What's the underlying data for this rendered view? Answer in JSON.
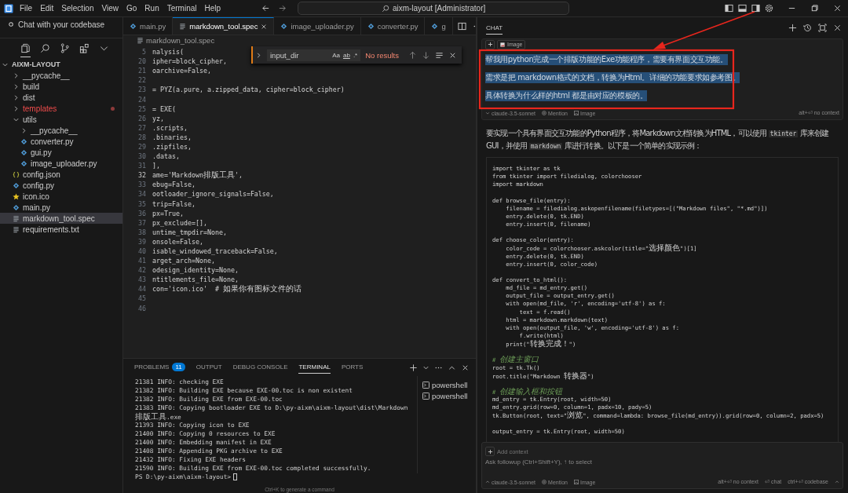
{
  "titlebar": {
    "menus": [
      "File",
      "Edit",
      "Selection",
      "View",
      "Go",
      "Run",
      "Terminal",
      "Help"
    ],
    "search": "aixm-layout [Administrator]"
  },
  "sidebar": {
    "chat_link": "Chat with your codebase",
    "views": [
      {
        "kind": "files",
        "selected": true
      },
      {
        "kind": "search",
        "selected": false
      },
      {
        "kind": "branch",
        "selected": false
      },
      {
        "kind": "extensions",
        "selected": false
      },
      {
        "kind": "more",
        "selected": false
      }
    ]
  },
  "explorer": {
    "title": "AIXM-LAYOUT",
    "expanded": true,
    "items": [
      {
        "name": "__pycache__",
        "kind": "folder",
        "expanded": false,
        "selected": false,
        "error": false
      },
      {
        "name": "build",
        "kind": "folder",
        "expanded": false,
        "selected": false,
        "error": false
      },
      {
        "name": "dist",
        "kind": "folder",
        "expanded": false,
        "selected": false,
        "error": false
      },
      {
        "name": "templates",
        "kind": "folder",
        "expanded": false,
        "selected": false,
        "error": true
      },
      {
        "name": "utils",
        "kind": "folder",
        "expanded": true,
        "selected": false,
        "error": false,
        "children": [
          {
            "name": "__pycache__",
            "kind": "folder",
            "expanded": false,
            "selected": false,
            "error": false
          },
          {
            "name": "converter.py",
            "kind": "python",
            "selected": false,
            "error": false
          },
          {
            "name": "gui.py",
            "kind": "python",
            "selected": false,
            "error": false
          },
          {
            "name": "image_uploader.py",
            "kind": "python",
            "selected": false,
            "error": false
          }
        ]
      },
      {
        "name": "config.json",
        "kind": "json",
        "selected": false,
        "error": false
      },
      {
        "name": "config.py",
        "kind": "python",
        "selected": false,
        "error": false
      },
      {
        "name": "icon.ico",
        "kind": "star",
        "selected": false,
        "error": false
      },
      {
        "name": "main.py",
        "kind": "python",
        "selected": false,
        "error": false
      },
      {
        "name": "markdown_tool.spec",
        "kind": "text",
        "selected": true,
        "error": false
      },
      {
        "name": "requirements.txt",
        "kind": "text",
        "selected": false,
        "error": false
      }
    ]
  },
  "editor": {
    "tabs": [
      {
        "label": "main.py",
        "kind": "python",
        "selected": false
      },
      {
        "label": "markdown_tool.spec",
        "kind": "text",
        "selected": true
      },
      {
        "label": "image_uploader.py",
        "kind": "python",
        "selected": false
      },
      {
        "label": "converter.py",
        "kind": "python",
        "selected": false
      },
      {
        "label": "g",
        "kind": "python",
        "selected": false
      }
    ],
    "breadcrumb": "markdown_tool.spec",
    "find": {
      "value": "input_dir",
      "options": [
        "Aa",
        "ab",
        ".*"
      ],
      "result": "No results"
    },
    "lines": [
      {
        "number": "5",
        "text": "nalysis(",
        "current": false
      },
      {
        "number": "20",
        "text": "ipher=block_cipher,",
        "current": false
      },
      {
        "number": "21",
        "text": "oarchive=False,",
        "current": false
      },
      {
        "number": "22",
        "current": false
      },
      {
        "number": "23",
        "text": "= PYZ(a.pure, a.zipped_data, cipher=block_cipher)",
        "current": false
      },
      {
        "number": "24",
        "current": false
      },
      {
        "number": "25",
        "text": "= EXE(",
        "current": false
      },
      {
        "number": "26",
        "text": "yz,",
        "current": false
      },
      {
        "number": "27",
        "text": ".scripts,",
        "current": false
      },
      {
        "number": "28",
        "text": ".binaries,",
        "current": false
      },
      {
        "number": "29",
        "text": ".zipfiles,",
        "current": false
      },
      {
        "number": "30",
        "text": ".datas,",
        "current": false
      },
      {
        "number": "31",
        "text": "],",
        "current": false
      },
      {
        "number": "32",
        "text": "ame='Markdown排版工具',",
        "current": true
      },
      {
        "number": "33",
        "text": "ebug=False,",
        "current": false
      },
      {
        "number": "34",
        "text": "ootloader_ignore_signals=False,",
        "current": false
      },
      {
        "number": "35",
        "text": "trip=False,",
        "current": false
      },
      {
        "number": "36",
        "text": "px=True,",
        "current": false
      },
      {
        "number": "37",
        "text": "px_exclude=[],",
        "current": false
      },
      {
        "number": "38",
        "text": "untime_tmpdir=None,",
        "current": false
      },
      {
        "number": "39",
        "text": "onsole=False,",
        "current": false
      },
      {
        "number": "40",
        "text": "isable_windowed_traceback=False,",
        "current": false
      },
      {
        "number": "41",
        "text": "arget_arch=None,",
        "current": false
      },
      {
        "number": "42",
        "text": "odesign_identity=None,",
        "current": false
      },
      {
        "number": "43",
        "text": "ntitlements_file=None,",
        "current": false
      },
      {
        "number": "44",
        "text": "con='icon.ico'  # 如果你有图标文件的话",
        "current": false
      },
      {
        "number": "45",
        "current": false
      },
      {
        "number": "46",
        "current": false
      }
    ]
  },
  "panel": {
    "tabs": [
      {
        "label": "PROBLEMS",
        "badge": "11",
        "selected": false
      },
      {
        "label": "OUTPUT",
        "selected": false
      },
      {
        "label": "DEBUG CONSOLE",
        "selected": false
      },
      {
        "label": "TERMINAL",
        "selected": true
      },
      {
        "label": "PORTS",
        "selected": false
      }
    ],
    "terminal_lines": [
      "21381 INFO: checking EXE",
      "21382 INFO: Building EXE because EXE-00.toc is non existent",
      "21382 INFO: Building EXE from EXE-00.toc",
      "21383 INFO: Copying bootloader EXE to D:\\py-aixm\\aixm-layout\\dist\\Markdown",
      "排版工具.exe",
      "21393 INFO: Copying icon to EXE",
      "21400 INFO: Copying 0 resources to EXE",
      "21400 INFO: Embedding manifest in EXE",
      "21408 INFO: Appending PKG archive to EXE",
      "21432 INFO: Fixing EXE headers",
      "21590 INFO: Building EXE from EXE-00.toc completed successfully."
    ],
    "prompt": "PS D:\\py-aixm\\aixm-layout>",
    "terminals": [
      "powershell",
      "powershell"
    ],
    "hint": "Ctrl+K to generate a command"
  },
  "chat": {
    "title": "CHAT",
    "message": {
      "chip": "Image",
      "lines": [
        "帮我用python完成一个排版功能的Exe功能程序，需要有界面交互功能。",
        "需求是把 markdown格式的文档，转换为Html。详细的功能要求如参考图。",
        "具体转换为什么样的html  都是由对应的模板的。"
      ],
      "model": "claude-3.5-sonnet",
      "mention": "Mention",
      "image": "Image",
      "shortcut": "alt+⏎ no context"
    },
    "answer": [
      {
        "text": "要实现一个具有界面交互功能的Python程序，将Markdown文档转换为HTML，可以使用 ",
        "code": false
      },
      {
        "text": "tkinter",
        "code": true
      },
      {
        "text": " 库来创建GUI，并使用 ",
        "code": false
      },
      {
        "text": "markdown",
        "code": true
      },
      {
        "text": " 库进行转换。以下是一个简单的实现示例：",
        "code": false
      }
    ],
    "code": [
      {
        "kind": "code",
        "text": "import tkinter as tk"
      },
      {
        "kind": "code",
        "text": "from tkinter import filedialog, colorchooser"
      },
      {
        "kind": "code",
        "text": "import markdown"
      },
      {
        "kind": "blank"
      },
      {
        "kind": "code",
        "text": "def browse_file(entry):"
      },
      {
        "kind": "code",
        "text": "    filename = filedialog.askopenfilename(filetypes=[(\"Markdown files\", \"*.md\")])"
      },
      {
        "kind": "code",
        "text": "    entry.delete(0, tk.END)"
      },
      {
        "kind": "code",
        "text": "    entry.insert(0, filename)"
      },
      {
        "kind": "blank"
      },
      {
        "kind": "code",
        "text": "def choose_color(entry):"
      },
      {
        "kind": "code",
        "text": "    color_code = colorchooser.askcolor(title=\"选择颜色\")[1]"
      },
      {
        "kind": "code",
        "text": "    entry.delete(0, tk.END)"
      },
      {
        "kind": "code",
        "text": "    entry.insert(0, color_code)"
      },
      {
        "kind": "blank"
      },
      {
        "kind": "code",
        "text": "def convert_to_html():"
      },
      {
        "kind": "code",
        "text": "    md_file = md_entry.get()"
      },
      {
        "kind": "code",
        "text": "    output_file = output_entry.get()"
      },
      {
        "kind": "code",
        "text": "    with open(md_file, 'r', encoding='utf-8') as f:"
      },
      {
        "kind": "code",
        "text": "        text = f.read()"
      },
      {
        "kind": "code",
        "text": "    html = markdown.markdown(text)"
      },
      {
        "kind": "code",
        "text": "    with open(output_file, 'w', encoding='utf-8') as f:"
      },
      {
        "kind": "code",
        "text": "        f.write(html)"
      },
      {
        "kind": "code",
        "text": "    print(\"转换完成！\")"
      },
      {
        "kind": "blank"
      },
      {
        "kind": "comment",
        "text": "# 创建主窗口"
      },
      {
        "kind": "code",
        "text": "root = tk.Tk()"
      },
      {
        "kind": "code",
        "text": "root.title(\"Markdown 转换器\")"
      },
      {
        "kind": "blank"
      },
      {
        "kind": "comment",
        "text": "# 创建输入框和按钮"
      },
      {
        "kind": "code",
        "text": "md_entry = tk.Entry(root, width=50)"
      },
      {
        "kind": "code",
        "text": "md_entry.grid(row=0, column=1, padx=10, pady=5)"
      },
      {
        "kind": "code",
        "text": "tk.Button(root, text=\"浏览\", command=lambda: browse_file(md_entry)).grid(row=0, column=2, padx=5)"
      },
      {
        "kind": "blank"
      },
      {
        "kind": "code",
        "text": "output_entry = tk.Entry(root, width=50)"
      }
    ],
    "input": {
      "context": "Add context",
      "placeholder": "Ask followup (Ctrl+Shift+Y), ↑ to select",
      "model": "claude-3.5-sonnet",
      "mention": "Mention",
      "image": "Image",
      "shortcuts": [
        "alt+⏎ no context",
        "⏎ chat",
        "ctrl+⏎ codebase"
      ]
    }
  }
}
